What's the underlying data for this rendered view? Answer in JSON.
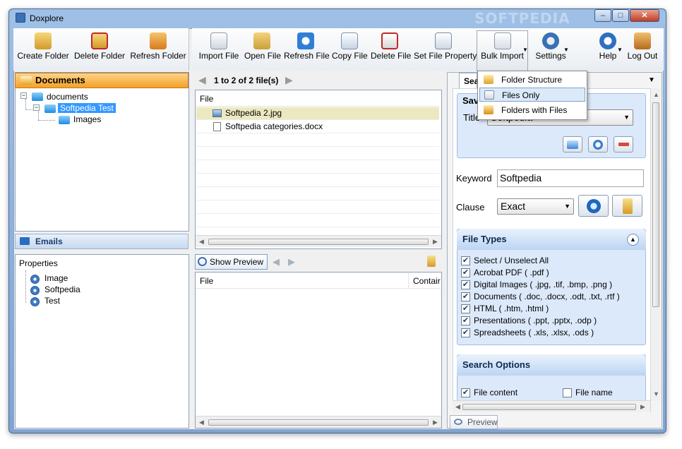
{
  "window": {
    "title": "Doxplore",
    "watermark": "SOFTPEDIA",
    "min_glyph": "–",
    "max_glyph": "□",
    "close_glyph": "✕"
  },
  "toolbar_left": [
    {
      "label": "Create Folder",
      "icon": "create-folder-icon"
    },
    {
      "label": "Delete Folder",
      "icon": "delete-folder-icon"
    },
    {
      "label": "Refresh Folder",
      "icon": "refresh-folder-icon"
    }
  ],
  "toolbar_right": [
    {
      "label": "Import File",
      "icon": "import-file-icon"
    },
    {
      "label": "Open File",
      "icon": "open-file-icon"
    },
    {
      "label": "Refresh File",
      "icon": "refresh-file-icon"
    },
    {
      "label": "Copy File",
      "icon": "copy-file-icon"
    },
    {
      "label": "Delete File",
      "icon": "delete-file-icon"
    },
    {
      "label": "Set File Property",
      "icon": "set-file-property-icon"
    },
    {
      "label": "Bulk Import",
      "icon": "bulk-import-icon"
    },
    {
      "label": "Settings",
      "icon": "settings-icon"
    },
    {
      "label": "Help",
      "icon": "help-icon"
    },
    {
      "label": "Log Out",
      "icon": "log-out-icon"
    }
  ],
  "bulk_import_menu": [
    {
      "label": "Folder Structure",
      "highlighted": false
    },
    {
      "label": "Files Only",
      "highlighted": true
    },
    {
      "label": "Folders with Files",
      "highlighted": false
    }
  ],
  "left_panel": {
    "documents_label": "Documents",
    "tree": [
      "documents",
      "Softpedia Test",
      "Images"
    ],
    "emails_label": "Emails",
    "properties_label": "Properties",
    "properties": [
      "Image",
      "Softpedia",
      "Test"
    ]
  },
  "file_list": {
    "pager": "1 to 2 of 2 file(s)",
    "column": "File",
    "files": [
      "Softpedia 2.jpg",
      "Softpedia categories.docx"
    ]
  },
  "preview_panel": {
    "show_preview_label": "Show Preview",
    "columns": [
      "File",
      "Contair"
    ]
  },
  "search": {
    "tab_label": "Sea",
    "saved_header": "Sav",
    "title_label": "Title",
    "title_value": "Softpedia",
    "keyword_label": "Keyword",
    "keyword_value": "Softpedia",
    "clause_label": "Clause",
    "clause_value": "Exact",
    "file_types_header": "File Types",
    "file_types": [
      "Select / Unselect  All",
      "Acrobat PDF ( .pdf )",
      "Digital Images ( .jpg, .tif, .bmp, .png )",
      "Documents ( .doc, .docx, .odt, .txt, .rtf )",
      "HTML ( .htm, .html )",
      "Presentations ( .ppt, .pptx, .odp )",
      "Spreadsheets ( .xls, .xlsx, .ods )"
    ],
    "search_options_header": "Search Options",
    "opt_file_content": "File content",
    "opt_file_name": "File name",
    "preview_tab": "Preview"
  }
}
